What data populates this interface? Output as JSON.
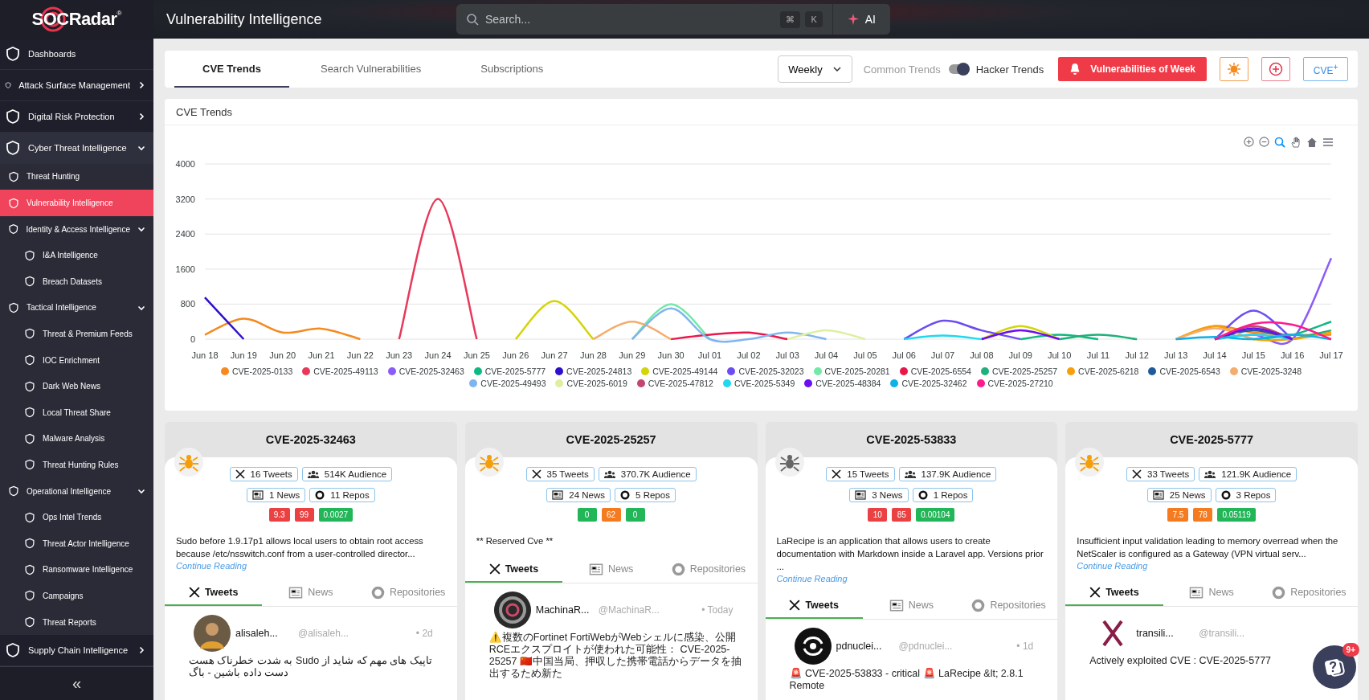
{
  "sidebar": {
    "logo": "SOCRadar",
    "logo_mark": "®",
    "items": [
      {
        "label": "Dashboards",
        "selected": false
      },
      {
        "label": "Attack Surface Management",
        "selected": false,
        "expanded": false
      },
      {
        "label": "Digital Risk Protection",
        "selected": false,
        "expanded": false
      },
      {
        "label": "Cyber Threat Intelligence",
        "selected": false,
        "expanded": true,
        "children": [
          {
            "label": "Threat Hunting",
            "selected": false
          },
          {
            "label": "Vulnerability Intelligence",
            "selected": true
          },
          {
            "label": "Identity & Access Intelligence",
            "selected": false,
            "expanded": true,
            "children": [
              {
                "label": "I&A Intelligence",
                "selected": false
              },
              {
                "label": "Breach Datasets",
                "selected": false
              }
            ]
          },
          {
            "label": "Tactical Intelligence",
            "selected": false,
            "expanded": true,
            "children": [
              {
                "label": "Threat & Premium Feeds",
                "selected": false
              },
              {
                "label": "IOC Enrichment",
                "selected": false
              },
              {
                "label": "Dark Web News",
                "selected": false
              },
              {
                "label": "Local Threat Share",
                "selected": false
              },
              {
                "label": "Malware Analysis",
                "selected": false
              },
              {
                "label": "Threat Hunting Rules",
                "selected": false
              }
            ]
          },
          {
            "label": "Operational Intelligence",
            "selected": false,
            "expanded": true,
            "children": [
              {
                "label": "Ops Intel Trends",
                "selected": false
              },
              {
                "label": "Threat Actor Intelligence",
                "selected": false
              },
              {
                "label": "Ransomware Intelligence",
                "selected": false
              },
              {
                "label": "Campaigns",
                "selected": false
              },
              {
                "label": "Threat Reports",
                "selected": false
              }
            ]
          }
        ]
      },
      {
        "label": "Supply Chain Intelligence",
        "selected": false,
        "expanded": false
      }
    ],
    "collapse": "«"
  },
  "header": {
    "title": "Vulnerability Intelligence",
    "search": {
      "placeholder": "Search...",
      "shortcut": [
        "⌘",
        "K"
      ]
    },
    "ai_button": "AI"
  },
  "tabs": [
    {
      "label": "CVE Trends",
      "selected": true
    },
    {
      "label": "Search Vulnerabilities",
      "selected": false
    },
    {
      "label": "Subscriptions",
      "selected": false
    }
  ],
  "period": "Weekly",
  "trend_toggle": {
    "left": "Common Trends",
    "right": "Hacker Trends",
    "on": true
  },
  "toolbar_buttons": [
    {
      "kind": "alert",
      "label": "Vulnerabilities of Week"
    },
    {
      "kind": "virus"
    },
    {
      "kind": "add"
    },
    {
      "kind": "cve",
      "label": "CVE$^{+}$"
    }
  ],
  "chart": {
    "title": "CVE Trends",
    "chart_data": {
      "type": "line",
      "grid": true,
      "categories": [
        "Jun 18",
        "Jun 19",
        "Jun 20",
        "Jun 21",
        "Jun 22",
        "Jun 23",
        "Jun 24",
        "Jun 25",
        "Jun 26",
        "Jun 27",
        "Jun 28",
        "Jun 29",
        "Jun 30",
        "Jul 01",
        "Jul 02",
        "Jul 03",
        "Jul 04",
        "Jul 05",
        "Jul 06",
        "Jul 07",
        "Jul 08",
        "Jul 09",
        "Jul 10",
        "Jul 11",
        "Jul 12",
        "Jul 13",
        "Jul 14",
        "Jul 15",
        "Jul 16",
        "Jul 17"
      ],
      "ylim": [
        0,
        4000
      ],
      "yticks": [
        0,
        800,
        1600,
        2400,
        3200,
        4000
      ],
      "series": [
        {
          "name": "CVE-2025-0133",
          "color": "#f58a1f",
          "values": [
            100,
            470,
            150,
            240,
            0,
            null,
            null,
            null,
            null,
            null,
            null,
            null,
            null,
            null,
            null,
            null,
            null,
            null,
            null,
            null,
            null,
            null,
            null,
            null,
            null,
            0,
            300,
            150,
            100,
            100
          ]
        },
        {
          "name": "CVE-2025-49113",
          "color": "#e8395a",
          "values": [
            null,
            null,
            null,
            null,
            null,
            0,
            3200,
            0,
            null,
            null,
            null,
            null,
            null,
            null,
            null,
            null,
            null,
            null,
            null,
            null,
            null,
            null,
            null,
            null,
            null,
            null,
            null,
            null,
            null,
            null
          ]
        },
        {
          "name": "CVE-2025-32463",
          "color": "#8b5cf6",
          "values": [
            null,
            null,
            null,
            null,
            null,
            null,
            null,
            null,
            null,
            null,
            null,
            null,
            null,
            null,
            null,
            null,
            null,
            null,
            null,
            null,
            null,
            null,
            null,
            null,
            null,
            null,
            0,
            100,
            0,
            1850
          ]
        },
        {
          "name": "CVE-2025-5777",
          "color": "#10b981",
          "values": [
            null,
            null,
            null,
            null,
            null,
            null,
            null,
            null,
            null,
            null,
            null,
            null,
            null,
            null,
            null,
            null,
            null,
            null,
            null,
            null,
            null,
            0,
            100,
            0,
            null,
            null,
            null,
            0,
            100,
            400
          ]
        },
        {
          "name": "CVE-2025-24813",
          "color": "#2e10cc",
          "values": [
            950,
            0,
            null,
            null,
            null,
            null,
            null,
            null,
            null,
            null,
            null,
            null,
            null,
            null,
            null,
            null,
            null,
            null,
            null,
            null,
            null,
            null,
            null,
            null,
            null,
            null,
            null,
            null,
            null,
            null
          ]
        },
        {
          "name": "CVE-2025-49144",
          "color": "#d4d40a",
          "values": [
            null,
            null,
            null,
            null,
            null,
            null,
            null,
            null,
            0,
            870,
            0,
            null,
            null,
            null,
            null,
            null,
            null,
            null,
            null,
            null,
            0,
            300,
            0,
            null,
            null,
            null,
            null,
            null,
            null,
            null
          ]
        },
        {
          "name": "CVE-2025-32023",
          "color": "#6d4df2",
          "values": [
            null,
            null,
            null,
            null,
            null,
            null,
            null,
            null,
            null,
            null,
            null,
            null,
            null,
            null,
            null,
            null,
            null,
            null,
            0,
            420,
            200,
            0,
            null,
            null,
            null,
            null,
            0,
            650,
            0,
            null
          ]
        },
        {
          "name": "CVE-2025-20281",
          "color": "#74e8a6",
          "values": [
            null,
            null,
            null,
            null,
            null,
            null,
            null,
            null,
            null,
            null,
            null,
            0,
            800,
            0,
            null,
            null,
            null,
            null,
            null,
            null,
            null,
            null,
            null,
            null,
            null,
            null,
            null,
            null,
            null,
            null
          ]
        },
        {
          "name": "CVE-2025-6554",
          "color": "#e8174a",
          "values": [
            null,
            null,
            null,
            null,
            null,
            null,
            null,
            null,
            null,
            null,
            null,
            null,
            0,
            100,
            150,
            0,
            null,
            null,
            null,
            null,
            null,
            null,
            null,
            null,
            null,
            null,
            null,
            null,
            null,
            null
          ]
        },
        {
          "name": "CVE-2025-25257",
          "color": "#20b07a",
          "values": [
            null,
            null,
            null,
            null,
            null,
            null,
            null,
            null,
            null,
            null,
            null,
            null,
            null,
            null,
            null,
            null,
            null,
            null,
            null,
            null,
            null,
            null,
            0,
            100,
            0,
            null,
            null,
            null,
            0,
            200
          ]
        },
        {
          "name": "CVE-2025-6218",
          "color": "#f5a00b",
          "values": [
            null,
            null,
            null,
            null,
            null,
            null,
            null,
            null,
            null,
            null,
            null,
            null,
            null,
            null,
            null,
            null,
            null,
            null,
            null,
            null,
            null,
            null,
            null,
            null,
            null,
            0,
            300,
            0,
            0,
            150
          ]
        },
        {
          "name": "CVE-2025-6543",
          "color": "#1e5a9c",
          "values": [
            null,
            null,
            null,
            null,
            null,
            null,
            null,
            null,
            null,
            null,
            null,
            null,
            null,
            null,
            null,
            null,
            null,
            null,
            null,
            null,
            null,
            null,
            null,
            null,
            null,
            null,
            0,
            200,
            0,
            null
          ]
        },
        {
          "name": "CVE-2025-3248",
          "color": "#f4ad6e",
          "values": [
            null,
            null,
            null,
            null,
            null,
            null,
            null,
            null,
            null,
            null,
            0,
            400,
            0,
            null,
            null,
            null,
            null,
            null,
            null,
            null,
            null,
            null,
            null,
            null,
            null,
            0,
            250,
            0,
            null,
            null
          ]
        },
        {
          "name": "CVE-2025-49493",
          "color": "#7fb5ef",
          "values": [
            null,
            null,
            null,
            null,
            null,
            null,
            null,
            null,
            null,
            null,
            null,
            0,
            700,
            0,
            0,
            150,
            0,
            null,
            null,
            null,
            null,
            null,
            null,
            null,
            null,
            null,
            null,
            null,
            null,
            null
          ]
        },
        {
          "name": "CVE-2025-6019",
          "color": "#dcf0a0",
          "values": [
            null,
            null,
            null,
            null,
            null,
            null,
            null,
            null,
            null,
            null,
            null,
            null,
            null,
            null,
            null,
            0,
            200,
            0,
            null,
            null,
            null,
            null,
            null,
            null,
            null,
            null,
            null,
            null,
            null,
            null
          ]
        },
        {
          "name": "CVE-2025-47812",
          "color": "#c24770",
          "values": [
            null,
            null,
            null,
            null,
            null,
            null,
            null,
            null,
            null,
            null,
            null,
            null,
            null,
            null,
            null,
            null,
            null,
            null,
            null,
            null,
            null,
            null,
            null,
            null,
            null,
            null,
            0,
            300,
            0,
            null
          ]
        },
        {
          "name": "CVE-2025-5349",
          "color": "#20d8f0",
          "values": [
            null,
            null,
            null,
            null,
            null,
            null,
            null,
            null,
            null,
            null,
            null,
            null,
            null,
            null,
            null,
            null,
            null,
            null,
            0,
            80,
            0,
            null,
            null,
            null,
            null,
            null,
            0,
            100,
            0,
            null
          ]
        },
        {
          "name": "CVE-2025-48384",
          "color": "#6a0ff0",
          "values": [
            null,
            null,
            null,
            null,
            null,
            null,
            null,
            null,
            null,
            null,
            null,
            null,
            null,
            null,
            null,
            null,
            null,
            null,
            null,
            null,
            0,
            200,
            0,
            null,
            null,
            null,
            0,
            250,
            0,
            null
          ]
        },
        {
          "name": "CVE-2025-32462",
          "color": "#10b0e8",
          "values": [
            null,
            null,
            null,
            null,
            null,
            null,
            null,
            null,
            null,
            null,
            null,
            null,
            null,
            null,
            null,
            null,
            null,
            null,
            null,
            null,
            null,
            null,
            null,
            null,
            null,
            0,
            50,
            0,
            100,
            0
          ]
        },
        {
          "name": "CVE-2025-27210",
          "color": "#ff1a8c",
          "values": [
            null,
            null,
            null,
            null,
            null,
            null,
            null,
            null,
            null,
            null,
            null,
            null,
            null,
            null,
            null,
            null,
            null,
            null,
            null,
            null,
            null,
            null,
            null,
            null,
            null,
            null,
            0,
            350,
            330,
            0
          ]
        }
      ]
    }
  },
  "cards": [
    {
      "title": "CVE-2025-32463",
      "color": "#f59e0b",
      "stats": [
        {
          "kind": "tweets",
          "text": "16 Tweets"
        },
        {
          "kind": "audience",
          "text": "514K Audience"
        },
        {
          "kind": "news",
          "text": "1 News"
        },
        {
          "kind": "repos",
          "text": "11 Repos"
        }
      ],
      "scores": [
        {
          "text": "9.3",
          "color": "#ea4242"
        },
        {
          "text": "99",
          "color": "#ea4242"
        },
        {
          "text": "0.0027",
          "color": "#22b659"
        }
      ],
      "description": "Sudo before 1.9.17p1 allows local users to obtain root access because /etc/nsswitch.conf from a user-controlled director...",
      "link": "Continue Reading",
      "tabs": [
        {
          "kind": "tweets",
          "label": "Tweets",
          "selected": true
        },
        {
          "kind": "news",
          "label": "News",
          "selected": false
        },
        {
          "kind": "repos",
          "label": "Repositories",
          "selected": false
        }
      ],
      "tweet": {
        "name": "alisaleh...",
        "handle": "@alisaleh...",
        "time": "• 2d",
        "text": "به شدت خطرناک هست Sudo تاپیک های مهم که شاید از دست داده باشین - باگ"
      }
    },
    {
      "title": "CVE-2025-25257",
      "color": "#f59e0b",
      "stats": [
        {
          "kind": "tweets",
          "text": "35 Tweets"
        },
        {
          "kind": "audience",
          "text": "370.7K Audience"
        },
        {
          "kind": "news",
          "text": "24 News"
        },
        {
          "kind": "repos",
          "text": "5 Repos"
        }
      ],
      "scores": [
        {
          "text": "0",
          "color": "#22b659"
        },
        {
          "text": "62",
          "color": "#f47b20"
        },
        {
          "text": "0",
          "color": "#22b659"
        }
      ],
      "description": "** Reserved Cve **",
      "tabs": [
        {
          "kind": "tweets",
          "label": "Tweets",
          "selected": true
        },
        {
          "kind": "news",
          "label": "News",
          "selected": false
        },
        {
          "kind": "repos",
          "label": "Repositories",
          "selected": false
        }
      ],
      "tweet": {
        "name": "MachinaR...",
        "handle": "@MachinaR...",
        "time": "• Today",
        "text": "⚠️複数のFortinet FortiWebがWebシェルに感染、公開RCEエクスプロイトが使われた可能性： CVE-2025-25257 🇨🇳中国当局、押収した携帯電話からデータを抽出するため新た"
      }
    },
    {
      "title": "CVE-2025-53833",
      "color": "#666666",
      "stats": [
        {
          "kind": "tweets",
          "text": "15 Tweets"
        },
        {
          "kind": "audience",
          "text": "137.9K Audience"
        },
        {
          "kind": "news",
          "text": "3 News"
        },
        {
          "kind": "repos",
          "text": "1 Repos"
        }
      ],
      "scores": [
        {
          "text": "10",
          "color": "#ea4242"
        },
        {
          "text": "85",
          "color": "#ea4242"
        },
        {
          "text": "0.00104",
          "color": "#22b659"
        }
      ],
      "description": "LaRecipe is an application that allows users to create documentation with Markdown inside a Laravel app. Versions prior ...",
      "link": "Continue Reading",
      "tabs": [
        {
          "kind": "tweets",
          "label": "Tweets",
          "selected": true
        },
        {
          "kind": "news",
          "label": "News",
          "selected": false
        },
        {
          "kind": "repos",
          "label": "Repositories",
          "selected": false
        }
      ],
      "tweet": {
        "name": "pdnuclei...",
        "handle": "@pdnuclei...",
        "time": "• 1d",
        "text": "🚨 CVE-2025-53833 - critical 🚨 LaRecipe &lt; 2.8.1 Remote"
      }
    },
    {
      "title": "CVE-2025-5777",
      "color": "#f59e0b",
      "stats": [
        {
          "kind": "tweets",
          "text": "33 Tweets"
        },
        {
          "kind": "audience",
          "text": "121.9K Audience"
        },
        {
          "kind": "news",
          "text": "25 News"
        },
        {
          "kind": "repos",
          "text": "3 Repos"
        }
      ],
      "scores": [
        {
          "text": "7.5",
          "color": "#f47b20"
        },
        {
          "text": "78",
          "color": "#f47b20"
        },
        {
          "text": "0.05119",
          "color": "#22b659"
        }
      ],
      "description": "Insufficient input validation leading to memory overread when the NetScaler is configured as a Gateway (VPN virtual serv...",
      "link": "Continue Reading",
      "tabs": [
        {
          "kind": "tweets",
          "label": "Tweets",
          "selected": true
        },
        {
          "kind": "news",
          "label": "News",
          "selected": false
        },
        {
          "kind": "repos",
          "label": "Repositories",
          "selected": false
        }
      ],
      "tweet": {
        "name": "transili...",
        "handle": "@transili...",
        "text": "Actively exploited CVE : CVE-2025-5777"
      }
    }
  ],
  "help": {
    "badge": "9+"
  }
}
